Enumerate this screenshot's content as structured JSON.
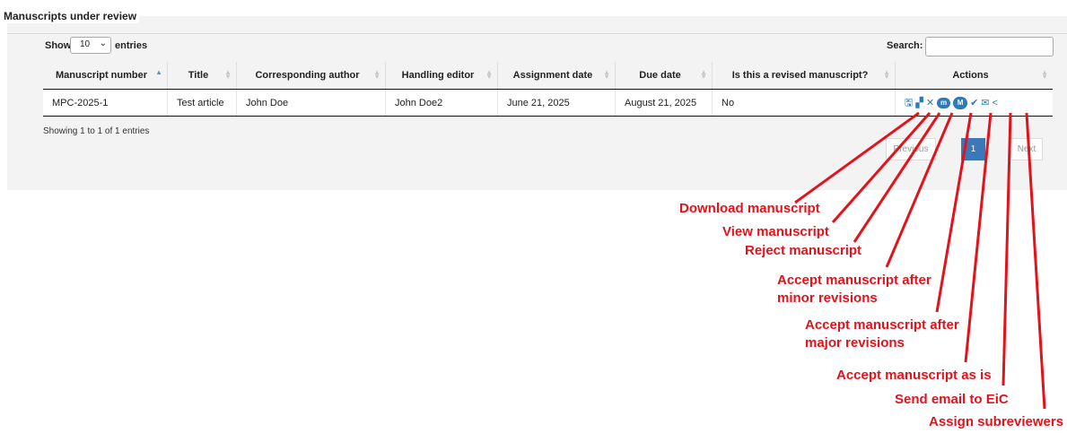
{
  "panel": {
    "legend": "Manuscripts under review"
  },
  "length_menu": {
    "show_label": "Show",
    "value": "10",
    "entries_label": "entries"
  },
  "search": {
    "label": "Search:",
    "value": ""
  },
  "table": {
    "headers": [
      "Manuscript number",
      "Title",
      "Corresponding author",
      "Handling editor",
      "Assignment date",
      "Due date",
      "Is this a revised manuscript?",
      "Actions"
    ],
    "rows": [
      {
        "manuscript_number": "MPC-2025-1",
        "title": "Test article",
        "corresponding_author": "John Doe",
        "handling_editor": "John Doe2",
        "assignment_date": "June 21, 2025",
        "due_date": "August 21, 2025",
        "revised": "No"
      }
    ],
    "action_icons": [
      "download-icon",
      "binoculars-icon",
      "times-icon",
      "minor-revision-m-icon",
      "major-revision-m-icon",
      "check-icon",
      "envelope-icon",
      "share-icon"
    ],
    "minor_letter": "m",
    "major_letter": "M"
  },
  "info": "Showing 1 to 1 of 1 entries",
  "pagination": {
    "previous": "Previous",
    "current": "1",
    "next": "Next"
  },
  "annotations": {
    "download": "Download manuscript",
    "view": "View manuscript",
    "reject": "Reject manuscript",
    "minor_1": "Accept manuscript after",
    "minor_2": "minor revisions",
    "major_1": "Accept manuscript after",
    "major_2": "major revisions",
    "as_is": "Accept manuscript as is",
    "email": "Send email to EiC",
    "subreviewers": "Assign subreviewers"
  },
  "colors": {
    "accent": "#2f79b9",
    "annotation": "#e3121b",
    "panel_bg": "#f3f3f3"
  }
}
